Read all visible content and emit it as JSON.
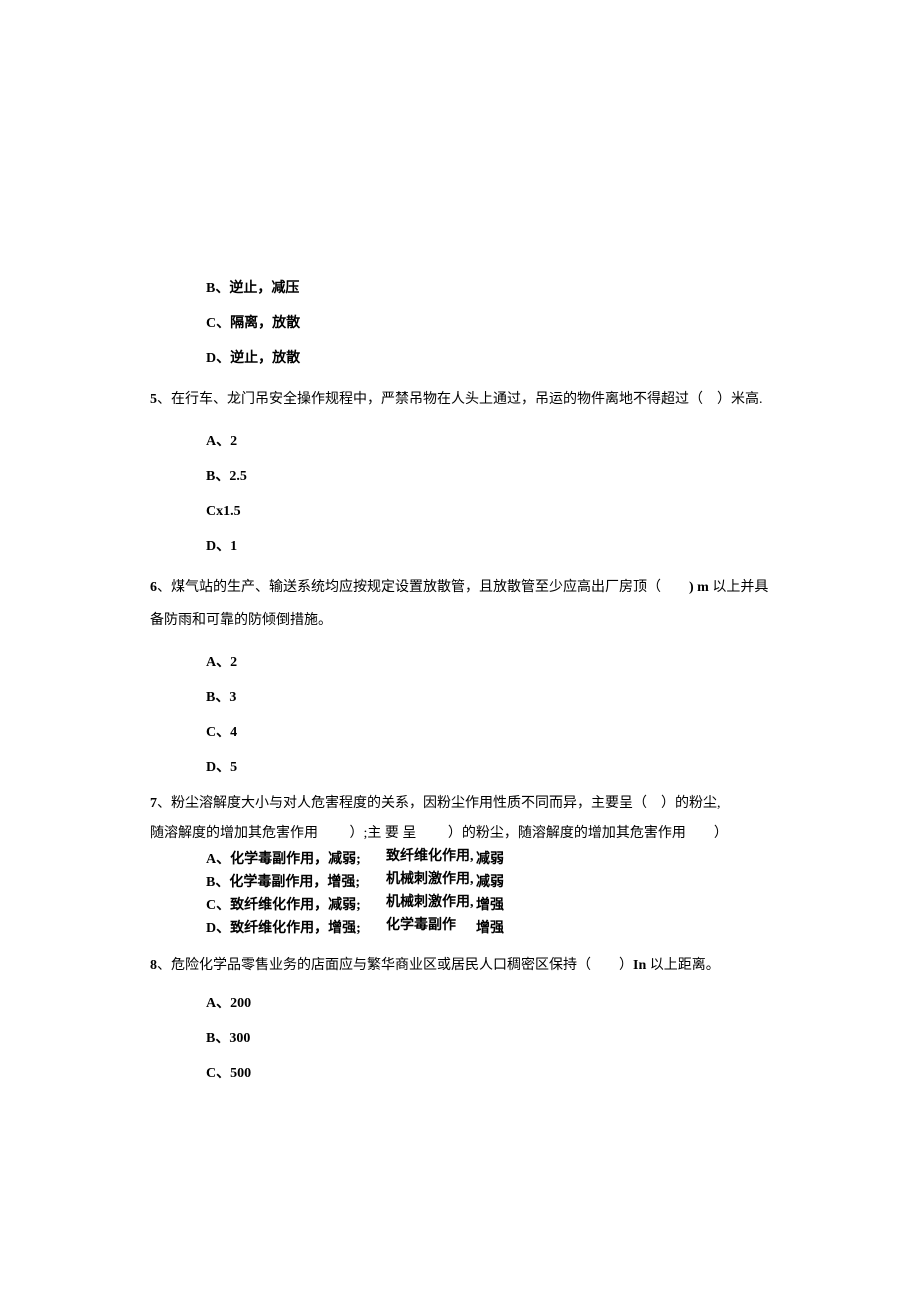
{
  "q4": {
    "optB": "B、逆止，减压",
    "optC": "C、隔离，放散",
    "optD": "D、逆止，放散"
  },
  "q5": {
    "num": "5",
    "text": "、在行车、龙门吊安全操作规程中，严禁吊物在人头上通过，吊运的物件离地不得超过（　）米高.",
    "optA": "A、2",
    "optB": "B、2.5",
    "optC": "Cx1.5",
    "optD": "D、1"
  },
  "q6": {
    "num": "6",
    "text_pre": "、煤气站的生产、输送系统均应按规定设置放散管，且放散管至少应高出厂房顶（　　",
    "text_unit": ") m",
    "text_post": " 以上并具备防雨和可靠的防倾倒措施。",
    "optA": "A、2",
    "optB": "B、3",
    "optC": "C、4",
    "optD": "D、5"
  },
  "q7": {
    "num": "7",
    "line1": "、粉尘溶解度大小与对人危害程度的关系，因粉尘作用性质不同而异，主要呈（　）的粉尘,",
    "line2": "随溶解度的增加其危害作用 　　）;主 要 呈 　　）的粉尘，随溶解度的增加其危害作用　　）",
    "optA_c1": "A、化学毒副作用，减弱;",
    "optA_c2": "致纤维化作用,",
    "optA_c3": "减弱",
    "optB_c1": "B、化学毒副作用，增强;",
    "optB_c2": "机械刺激作用,",
    "optB_c3": "减弱",
    "optC_c1": "C、致纤维化作用，减弱;",
    "optC_c2": "机械刺激作用,",
    "optC_c3": "增强",
    "optD_c1": "D、致纤维化作用，增强;",
    "optD_c2": "化学毒副作",
    "optD_c3": "增强"
  },
  "q8": {
    "num": "8",
    "text_pre": "、危险化学品零售业务的店面应与繁华商业区或居民人口稠密区保持（　　）",
    "text_unit": "In",
    "text_post": " 以上距离。",
    "optA": "A、200",
    "optB": "B、300",
    "optC": "C、500"
  }
}
